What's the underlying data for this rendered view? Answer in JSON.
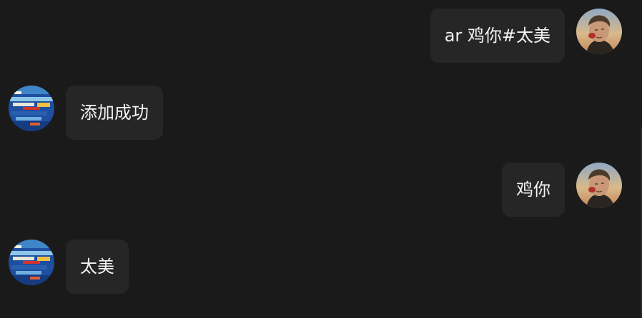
{
  "messages": [
    {
      "side": "right",
      "sender": "user",
      "text": "ar 鸡你#太美",
      "avatar": "portrait-photo"
    },
    {
      "side": "left",
      "sender": "bot",
      "text": "添加成功",
      "avatar": "painted-globe"
    },
    {
      "side": "right",
      "sender": "user",
      "text": "鸡你",
      "avatar": "portrait-photo"
    },
    {
      "side": "left",
      "sender": "bot",
      "text": "太美",
      "avatar": "painted-globe"
    }
  ],
  "colors": {
    "background": "#1a1a1a",
    "bubble": "#262626",
    "text": "#f2f2f2"
  }
}
